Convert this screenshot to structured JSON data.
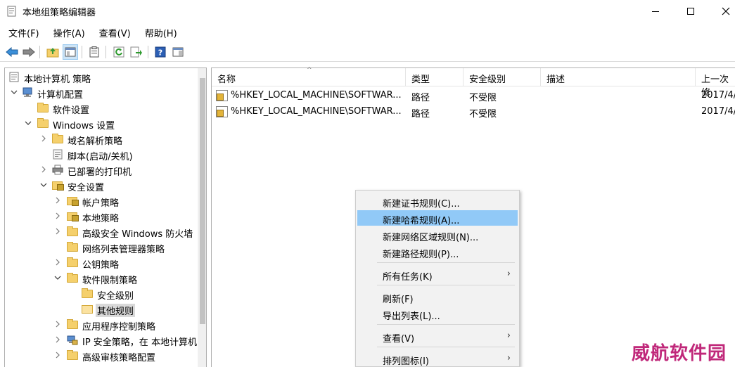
{
  "window": {
    "title": "本地组策略编辑器"
  },
  "menubar": [
    "文件(F)",
    "操作(A)",
    "查看(V)",
    "帮助(H)"
  ],
  "toolbar": {
    "icons": [
      "back-icon",
      "forward-icon",
      "up-folder-icon",
      "show-hide-tree-icon",
      "properties-icon",
      "refresh-icon",
      "export-list-icon",
      "help-icon",
      "action-pane-icon"
    ]
  },
  "tree": [
    {
      "label": "本地计算机 策略",
      "icon": "computer-policy-icon"
    },
    {
      "label": "计算机配置",
      "icon": "computer-icon"
    },
    {
      "label": "软件设置",
      "icon": "folder-icon"
    },
    {
      "label": "Windows 设置",
      "icon": "folder-icon"
    },
    {
      "label": "域名解析策略",
      "icon": "folder-icon"
    },
    {
      "label": "脚本(启动/关机)",
      "icon": "script-icon"
    },
    {
      "label": "已部署的打印机",
      "icon": "printer-icon"
    },
    {
      "label": "安全设置",
      "icon": "security-icon"
    },
    {
      "label": "帐户策略",
      "icon": "lock-folder-icon"
    },
    {
      "label": "本地策略",
      "icon": "lock-folder-icon"
    },
    {
      "label": "高级安全 Windows 防火墙",
      "icon": "folder-icon"
    },
    {
      "label": "网络列表管理器策略",
      "icon": "folder-icon"
    },
    {
      "label": "公钥策略",
      "icon": "folder-icon"
    },
    {
      "label": "软件限制策略",
      "icon": "folder-icon"
    },
    {
      "label": "安全级别",
      "icon": "folder-icon"
    },
    {
      "label": "其他规则",
      "icon": "folder-open-icon"
    },
    {
      "label": "应用程序控制策略",
      "icon": "folder-icon"
    },
    {
      "label": "IP 安全策略，在 本地计算机",
      "icon": "ip-security-icon"
    },
    {
      "label": "高级审核策略配置",
      "icon": "folder-icon"
    }
  ],
  "list": {
    "columns": [
      "名称",
      "类型",
      "安全级别",
      "描述",
      "上一次修"
    ],
    "rows": [
      {
        "name": "%HKEY_LOCAL_MACHINE\\SOFTWAR...",
        "type": "路径",
        "level": "不受限",
        "desc": "",
        "modified": "2017/4/"
      },
      {
        "name": "%HKEY_LOCAL_MACHINE\\SOFTWAR...",
        "type": "路径",
        "level": "不受限",
        "desc": "",
        "modified": "2017/4/"
      }
    ]
  },
  "context_menu": {
    "items": [
      {
        "label": "新建证书规则(C)...",
        "submenu": false
      },
      {
        "label": "新建哈希规则(A)...",
        "submenu": false
      },
      {
        "label": "新建网络区域规则(N)...",
        "submenu": false
      },
      {
        "label": "新建路径规则(P)...",
        "submenu": false
      },
      {
        "label": "所有任务(K)",
        "submenu": true
      },
      {
        "label": "刷新(F)",
        "submenu": false
      },
      {
        "label": "导出列表(L)...",
        "submenu": false
      },
      {
        "label": "查看(V)",
        "submenu": true
      },
      {
        "label": "排列图标(I)",
        "submenu": true
      }
    ],
    "submenu_glyph": "›"
  },
  "watermark": "威航软件园",
  "colors": {
    "highlight": "#91c9f7",
    "selected_tree": "#d9d9d9",
    "watermark": "#c0287a"
  }
}
